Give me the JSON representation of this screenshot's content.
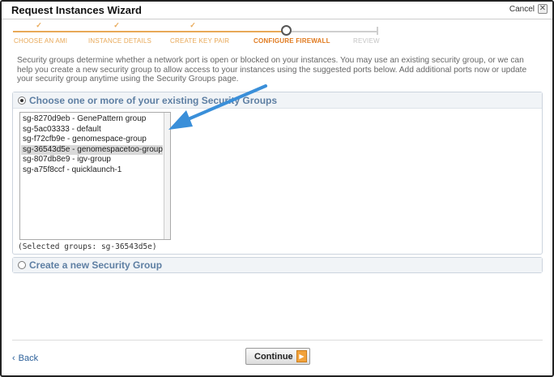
{
  "window": {
    "title": "Request Instances Wizard",
    "cancel_label": "Cancel"
  },
  "steps": [
    {
      "label": "CHOOSE AN AMI",
      "state": "done"
    },
    {
      "label": "INSTANCE DETAILS",
      "state": "done"
    },
    {
      "label": "CREATE KEY PAIR",
      "state": "done"
    },
    {
      "label": "CONFIGURE FIREWALL",
      "state": "current"
    },
    {
      "label": "REVIEW",
      "state": "future"
    }
  ],
  "intro": "Security groups determine whether a network port is open or blocked on your instances. You may use an existing security group, or we can help you create a new security group to allow access to your instances using the suggested ports below. Add additional ports now or update your security group anytime using the Security Groups page.",
  "existing": {
    "title": "Choose one or more of your existing Security Groups",
    "groups": [
      "sg-8270d9eb - GenePattern group",
      "sg-5ac03333 - default",
      "sg-f72cfb9e - genomespace-group",
      "sg-36543d5e - genomespacetoo-group",
      "sg-807db8e9 - igv-group",
      "sg-a75f8ccf - quicklaunch-1"
    ],
    "selected_index": 3,
    "selected_text": "(Selected groups: sg-36543d5e)"
  },
  "new_group": {
    "title": "Create a new Security Group"
  },
  "footer": {
    "back_label": "Back",
    "continue_label": "Continue"
  },
  "colors": {
    "accent": "#e8a857",
    "link": "#2a5f99",
    "arrow": "#3a8fd9"
  }
}
